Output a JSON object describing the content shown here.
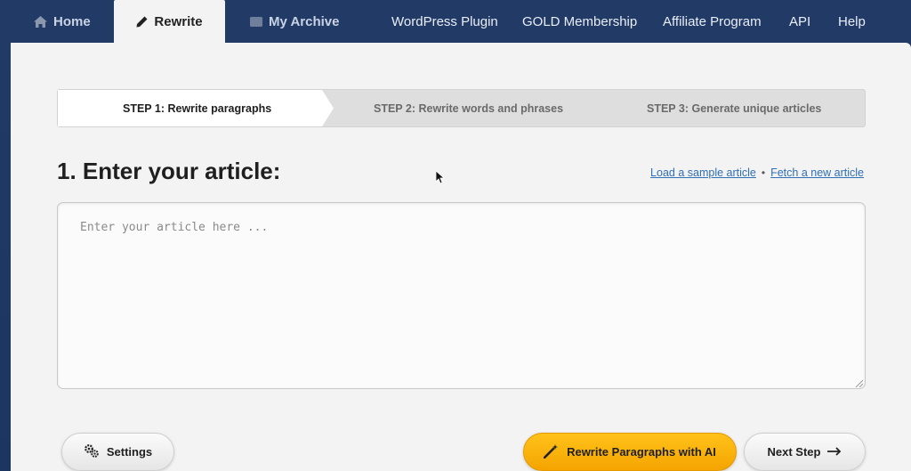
{
  "nav": {
    "home": "Home",
    "rewrite": "Rewrite",
    "archive": "My Archive",
    "wordpress": "WordPress Plugin",
    "gold": "GOLD Membership",
    "affiliate": "Affiliate Program",
    "api": "API",
    "help": "Help"
  },
  "steps": {
    "step1": "STEP 1: Rewrite paragraphs",
    "step2": "STEP 2: Rewrite words and phrases",
    "step3": "STEP 3: Generate unique articles"
  },
  "main": {
    "title": "1. Enter your article:",
    "load_sample": "Load a sample article",
    "separator": "•",
    "fetch_new": "Fetch a new article",
    "article_placeholder": "Enter your article here ...",
    "article_value": ""
  },
  "buttons": {
    "settings": "Settings",
    "rewrite_ai": "Rewrite Paragraphs with AI",
    "next_step": "Next Step"
  },
  "colors": {
    "nav_bg": "#223a66",
    "panel_bg": "#f3f3f3",
    "accent_orange": "#f5a400",
    "link_blue": "#2f6fb5"
  }
}
